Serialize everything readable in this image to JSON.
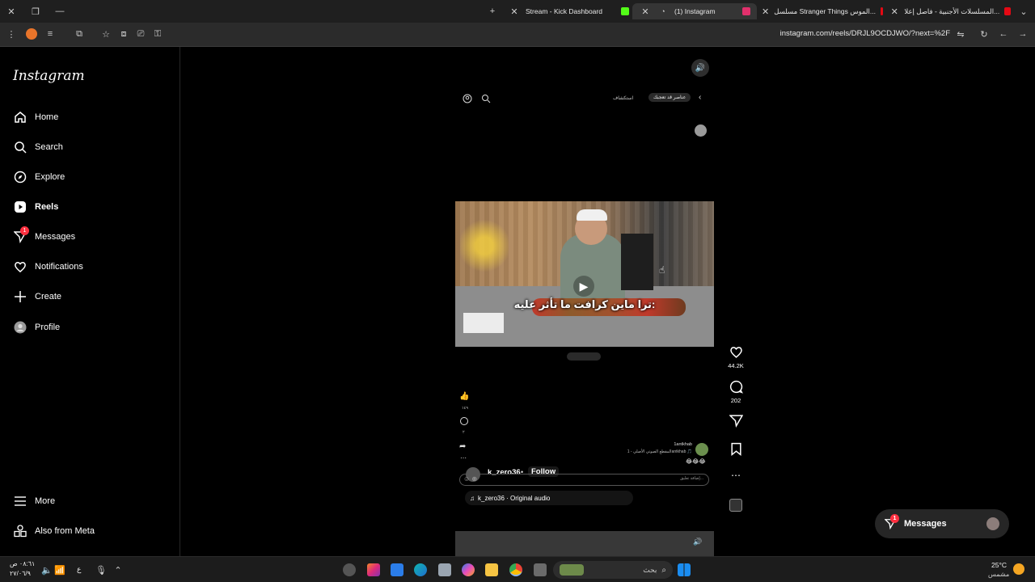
{
  "browser": {
    "tabs": [
      {
        "label": "Stream - Kick Dashboard",
        "favicon_color": "#53fc18"
      },
      {
        "label": "(1) Instagram",
        "favicon_color": "#e1306c",
        "active": true
      },
      {
        "label": "مسلسل Stranger Things الموس...",
        "favicon_color": "#e50914"
      },
      {
        "label": "المسلسلات الأجنبية - فاصل إعلا...",
        "favicon_color": "#e50914"
      }
    ],
    "address": "instagram.com/reels/DRJL9OCDJWO/?next=%2F"
  },
  "sidebar": {
    "logo": "Instagram",
    "items": [
      {
        "label": "Home",
        "icon": "home-icon"
      },
      {
        "label": "Search",
        "icon": "search-icon"
      },
      {
        "label": "Explore",
        "icon": "explore-icon"
      },
      {
        "label": "Reels",
        "icon": "reels-icon"
      },
      {
        "label": "Messages",
        "icon": "messages-icon",
        "badge": "1"
      },
      {
        "label": "Notifications",
        "icon": "heart-icon"
      },
      {
        "label": "Create",
        "icon": "plus-icon"
      },
      {
        "label": "Profile",
        "icon": "profile-icon"
      }
    ],
    "bottom": [
      {
        "label": "More",
        "icon": "menu-icon"
      },
      {
        "label": "Also from Meta",
        "icon": "meta-icon"
      }
    ]
  },
  "reel": {
    "inner_tab_1": "عناصر قد تعجبك",
    "inner_tab_2": "استكشاف",
    "subtitle": "ترا ماين كرافت ما تأثر عليه:",
    "inner_caption_user": "1antkhab",
    "inner_caption_text": "المقطع الصوتي الأصلي - 1antkhab 🎵",
    "inner_emojis": "😂😂😂",
    "inner_like_count": "١٤٩",
    "inner_comment_count": "٢",
    "inner_comment_placeholder": "إضافة تعليق...",
    "username": "k_zero36",
    "follow_label": "Follow",
    "audio": "k_zero36 · Original audio",
    "likes": "44.2K",
    "comments": "202"
  },
  "messages_button": {
    "label": "Messages",
    "badge": "1"
  },
  "taskbar": {
    "time": "٠٨:٦١ ص",
    "date": "٢٧/٠٦/٩",
    "lang": "ع",
    "search_placeholder": "بحث",
    "weather_temp": "25°C",
    "weather_desc": "مشمس"
  }
}
